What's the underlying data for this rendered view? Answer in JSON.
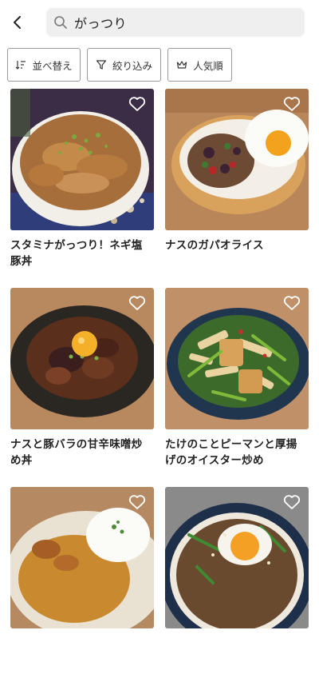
{
  "header": {
    "back_icon": "chevron-left-icon",
    "search_icon": "search-icon",
    "search_query": "がっつり"
  },
  "filters": [
    {
      "label": "並べ替え",
      "icon": "sort-icon"
    },
    {
      "label": "絞り込み",
      "icon": "funnel-icon"
    },
    {
      "label": "人気順",
      "icon": "crown-icon"
    }
  ],
  "recipes": [
    {
      "title": "スタミナがっつり！ネギ塩豚丼",
      "favorite_icon": "heart-outline-icon"
    },
    {
      "title": "ナスのガパオライス",
      "favorite_icon": "heart-outline-icon"
    },
    {
      "title": "ナスと豚バラの甘辛味噌炒め丼",
      "favorite_icon": "heart-outline-icon"
    },
    {
      "title": "たけのことピーマンと厚揚げのオイスター炒め",
      "favorite_icon": "heart-outline-icon"
    },
    {
      "title": "",
      "favorite_icon": "heart-outline-icon"
    },
    {
      "title": "",
      "favorite_icon": "heart-outline-icon"
    }
  ],
  "colors": {
    "search_bg": "#efefef",
    "chip_border": "#9a9a9a",
    "text": "#222222"
  }
}
